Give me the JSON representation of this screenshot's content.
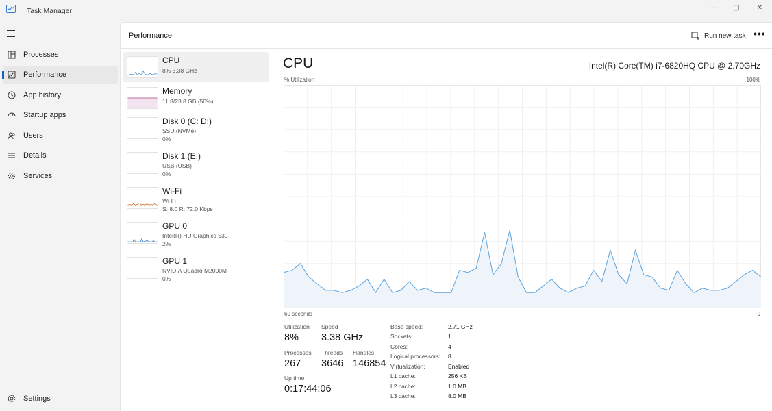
{
  "window": {
    "title": "Task Manager",
    "controls": {
      "minimize": "—",
      "maximize": "▢",
      "close": "✕"
    }
  },
  "sidebar": {
    "menu_icon": "hamburger-icon",
    "items": [
      {
        "label": "Processes",
        "icon": "processes-icon",
        "active": false
      },
      {
        "label": "Performance",
        "icon": "performance-icon",
        "active": true
      },
      {
        "label": "App history",
        "icon": "history-icon",
        "active": false
      },
      {
        "label": "Startup apps",
        "icon": "startup-icon",
        "active": false
      },
      {
        "label": "Users",
        "icon": "users-icon",
        "active": false
      },
      {
        "label": "Details",
        "icon": "details-icon",
        "active": false
      },
      {
        "label": "Services",
        "icon": "services-icon",
        "active": false
      }
    ],
    "settings": {
      "label": "Settings",
      "icon": "gear-icon"
    }
  },
  "header": {
    "title": "Performance",
    "run_new_task": "Run new task",
    "more": "•••"
  },
  "devices": [
    {
      "name": "CPU",
      "line1": "8%  3.38 GHz",
      "line2": "",
      "color": "#3a8fd6",
      "active": true
    },
    {
      "name": "Memory",
      "line1": "11.8/23.8 GB (50%)",
      "line2": "",
      "color": "#a0428a",
      "active": false
    },
    {
      "name": "Disk 0 (C: D:)",
      "line1": "SSD (NVMe)",
      "line2": "0%",
      "color": "#4a9a3a",
      "active": false
    },
    {
      "name": "Disk 1 (E:)",
      "line1": "USB (USB)",
      "line2": "0%",
      "color": "#4a9a3a",
      "active": false
    },
    {
      "name": "Wi-Fi",
      "line1": "Wi-Fi",
      "line2": "S: 8.0  R: 72.0 Kbps",
      "color": "#c8621e",
      "active": false
    },
    {
      "name": "GPU 0",
      "line1": "Intel(R) HD Graphics 530",
      "line2": "2%",
      "color": "#1d6fb8",
      "active": false
    },
    {
      "name": "GPU 1",
      "line1": "NVIDIA Quadro M2000M",
      "line2": "0%",
      "color": "#1d6fb8",
      "active": false
    }
  ],
  "detail": {
    "title": "CPU",
    "model": "Intel(R) Core(TM) i7-6820HQ CPU @ 2.70GHz",
    "graph_label": "% Utilization",
    "graph_max": "100%",
    "time_left": "60 seconds",
    "time_right": "0",
    "stats": {
      "utilization": {
        "label": "Utilization",
        "value": "8%"
      },
      "speed": {
        "label": "Speed",
        "value": "3.38 GHz"
      },
      "processes": {
        "label": "Processes",
        "value": "267"
      },
      "threads": {
        "label": "Threads",
        "value": "3646"
      },
      "handles": {
        "label": "Handles",
        "value": "146854"
      },
      "uptime": {
        "label": "Up time",
        "value": "0:17:44:06"
      }
    },
    "specs": [
      {
        "label": "Base speed:",
        "value": "2.71 GHz"
      },
      {
        "label": "Sockets:",
        "value": "1"
      },
      {
        "label": "Cores:",
        "value": "4"
      },
      {
        "label": "Logical processors:",
        "value": "8"
      },
      {
        "label": "Virtualization:",
        "value": "Enabled"
      },
      {
        "label": "L1 cache:",
        "value": "256 KB"
      },
      {
        "label": "L2 cache:",
        "value": "1.0 MB"
      },
      {
        "label": "L3 cache:",
        "value": "8.0 MB"
      }
    ]
  },
  "chart_data": {
    "type": "area",
    "xlabel": "60 seconds",
    "ylabel": "% Utilization",
    "x_range": [
      60,
      0
    ],
    "ylim": [
      0,
      100
    ],
    "grid": true,
    "color": "#5aa2dc",
    "fill": "#eef4fa",
    "series": [
      {
        "values": [
          16,
          17,
          20,
          14,
          11,
          8,
          8,
          7,
          8,
          10,
          13,
          7,
          13,
          7,
          8,
          12,
          8,
          9,
          7,
          7,
          7,
          17,
          16,
          18,
          34,
          15,
          20,
          35,
          14,
          7,
          7,
          10,
          13,
          9,
          7,
          9,
          10,
          17,
          12,
          26,
          15,
          11,
          26,
          15,
          14,
          9,
          8,
          17,
          11,
          7,
          9,
          8,
          8,
          9,
          12,
          15,
          17,
          14
        ]
      }
    ]
  }
}
